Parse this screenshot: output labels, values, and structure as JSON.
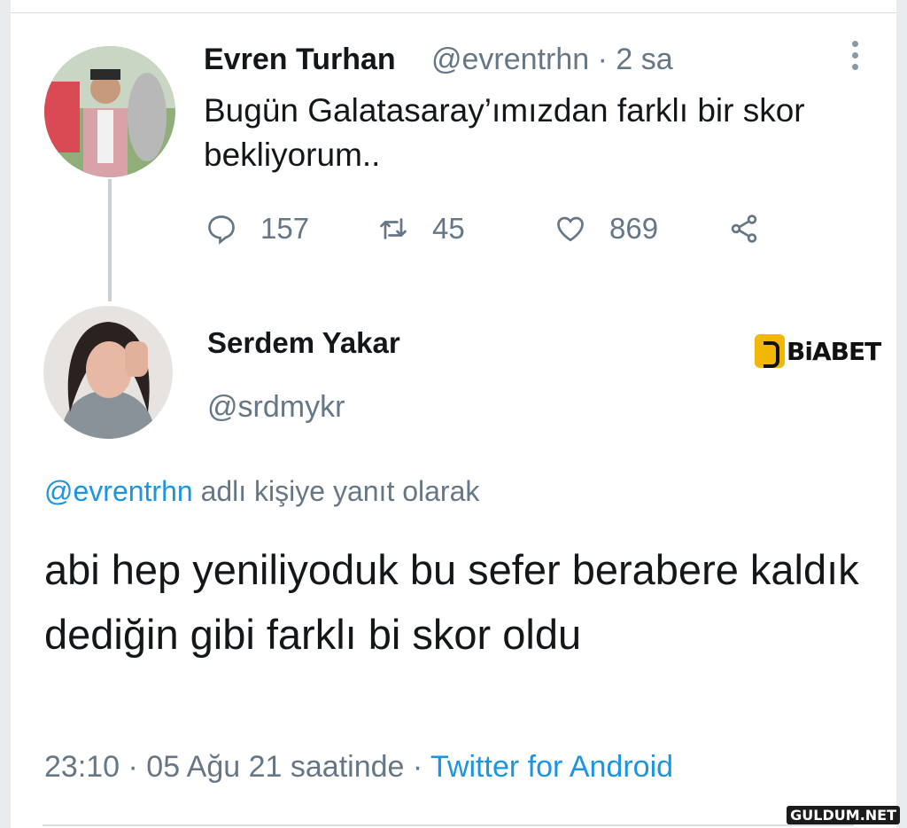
{
  "tweet": {
    "author_name": "Evren Turhan",
    "handle": "@evrentrhn",
    "time": "· 2 sa",
    "text": "Bugün Galatasaray’ımızdan  farklı bir skor bekliyorum..",
    "replies": "157",
    "retweets": "45",
    "likes": "869",
    "icons": [
      "more-icon",
      "reply-icon",
      "retweet-icon",
      "like-icon",
      "share-icon"
    ]
  },
  "reply": {
    "author_name": "Serdem Yakar",
    "handle": "@srdmykr",
    "context_mention": "@evrentrhn",
    "context_text": " adlı kişiye yanıt olarak",
    "text": "abi hep yeniliyoduk bu sefer berabere kaldık dediğin gibi farklı bi skor oldu",
    "timestamp": "23:10 · 05 Ağu 21 saatinde · ",
    "client": "Twitter for Android"
  },
  "overlays": {
    "brand_logo_text": "BiABET",
    "watermark": "GULDUM.NET"
  },
  "colors": {
    "link": "#1b95e0",
    "secondary_text": "#657786",
    "primary_text": "#14171a"
  }
}
